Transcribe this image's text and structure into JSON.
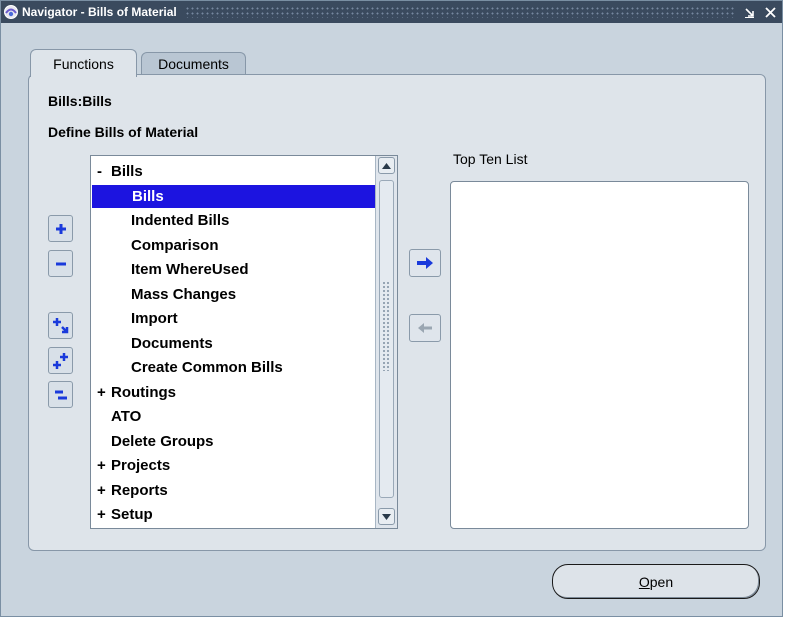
{
  "window": {
    "title": "Navigator - Bills of Material",
    "minimize_glyph": "⌄",
    "close_glyph": "✕"
  },
  "tabs": [
    {
      "label": "Functions",
      "active": true
    },
    {
      "label": "Documents",
      "active": false
    }
  ],
  "breadcrumb": "Bills:Bills",
  "section_title": "Define Bills of Material",
  "tree": {
    "items": [
      {
        "label": "Bills",
        "sign": "-",
        "level": 0,
        "selected": false
      },
      {
        "label": "Bills",
        "sign": "",
        "level": 1,
        "selected": true
      },
      {
        "label": "Indented Bills",
        "sign": "",
        "level": 1,
        "selected": false
      },
      {
        "label": "Comparison",
        "sign": "",
        "level": 1,
        "selected": false
      },
      {
        "label": "Item WhereUsed",
        "sign": "",
        "level": 1,
        "selected": false
      },
      {
        "label": "Mass Changes",
        "sign": "",
        "level": 1,
        "selected": false
      },
      {
        "label": "Import",
        "sign": "",
        "level": 1,
        "selected": false
      },
      {
        "label": "Documents",
        "sign": "",
        "level": 1,
        "selected": false
      },
      {
        "label": "Create Common Bills",
        "sign": "",
        "level": 1,
        "selected": false
      },
      {
        "label": "Routings",
        "sign": "+",
        "level": 0,
        "selected": false
      },
      {
        "label": "ATO",
        "sign": "",
        "level": 0,
        "selected": false
      },
      {
        "label": "Delete Groups",
        "sign": "",
        "level": 0,
        "selected": false
      },
      {
        "label": "Projects",
        "sign": "+",
        "level": 0,
        "selected": false
      },
      {
        "label": "Reports",
        "sign": "+",
        "level": 0,
        "selected": false
      },
      {
        "label": "Setup",
        "sign": "+",
        "level": 0,
        "selected": false
      }
    ]
  },
  "side_buttons": [
    {
      "name": "expand-button",
      "icon": "plus-icon"
    },
    {
      "name": "collapse-button",
      "icon": "minus-icon"
    },
    {
      "name": "expand-branch-button",
      "icon": "expand-branch-icon"
    },
    {
      "name": "expand-all-button",
      "icon": "expand-all-icon"
    },
    {
      "name": "collapse-all-button",
      "icon": "collapse-all-icon"
    }
  ],
  "top_ten": {
    "label": "Top Ten List",
    "items": []
  },
  "buttons": {
    "open_prefix": "",
    "open_mnemonic": "O",
    "open_rest": "pen"
  },
  "colors": {
    "titlebar": "#3a4a5e",
    "selection": "#1c14e0",
    "panel": "#dee4ea",
    "background": "#c9d4de",
    "icon_blue": "#1a3adb"
  }
}
